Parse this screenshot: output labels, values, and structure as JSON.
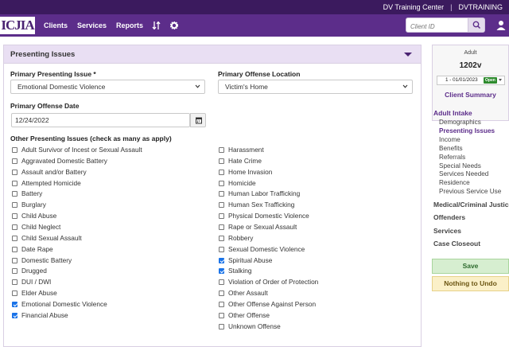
{
  "topbar": {
    "center": "DV Training Center",
    "separator": "|",
    "user": "DVTRAINING"
  },
  "navbar": {
    "logo": "ICJIA",
    "items": [
      "Clients",
      "Services",
      "Reports"
    ],
    "sort_icon": "sort-icon",
    "settings_icon": "gear-icon",
    "search": {
      "placeholder": "Client ID",
      "value": ""
    },
    "user_icon": "user-icon"
  },
  "panel": {
    "title": "Presenting Issues",
    "primary_issue_label": "Primary Presenting Issue *",
    "primary_issue_value": "Emotional Domestic Violence",
    "location_label": "Primary Offense Location",
    "location_value": "Victim's Home",
    "date_label": "Primary Offense Date",
    "date_value": "12/24/2022",
    "other_label": "Other Presenting Issues (check as many as apply)",
    "left_options": [
      {
        "label": "Adult Survivor of Incest or Sexual Assault",
        "checked": false
      },
      {
        "label": "Aggravated Domestic Battery",
        "checked": false
      },
      {
        "label": "Assault and/or Battery",
        "checked": false
      },
      {
        "label": "Attempted Homicide",
        "checked": false
      },
      {
        "label": "Battery",
        "checked": false
      },
      {
        "label": "Burglary",
        "checked": false
      },
      {
        "label": "Child Abuse",
        "checked": false
      },
      {
        "label": "Child Neglect",
        "checked": false
      },
      {
        "label": "Child Sexual Assault",
        "checked": false
      },
      {
        "label": "Date Rape",
        "checked": false
      },
      {
        "label": "Domestic Battery",
        "checked": false
      },
      {
        "label": "Drugged",
        "checked": false
      },
      {
        "label": "DUI / DWI",
        "checked": false
      },
      {
        "label": "Elder Abuse",
        "checked": false
      },
      {
        "label": "Emotional Domestic Violence",
        "checked": true
      },
      {
        "label": "Financial Abuse",
        "checked": true
      }
    ],
    "right_options": [
      {
        "label": "Harassment",
        "checked": false
      },
      {
        "label": "Hate Crime",
        "checked": false
      },
      {
        "label": "Home Invasion",
        "checked": false
      },
      {
        "label": "Homicide",
        "checked": false
      },
      {
        "label": "Human Labor Trafficking",
        "checked": false
      },
      {
        "label": "Human Sex Trafficking",
        "checked": false
      },
      {
        "label": "Physical Domestic Violence",
        "checked": false
      },
      {
        "label": "Rape or Sexual Assault",
        "checked": false
      },
      {
        "label": "Robbery",
        "checked": false
      },
      {
        "label": "Sexual Domestic Violence",
        "checked": false
      },
      {
        "label": "Spiritual Abuse",
        "checked": true
      },
      {
        "label": "Stalking",
        "checked": true
      },
      {
        "label": "Violation of Order of Protection",
        "checked": false
      },
      {
        "label": "Other Assault",
        "checked": false
      },
      {
        "label": "Other Offense Against Person",
        "checked": false
      },
      {
        "label": "Other Offense",
        "checked": false
      },
      {
        "label": "Unknown Offense",
        "checked": false
      }
    ]
  },
  "sidebar": {
    "client_type": "Adult",
    "client_id": "1202v",
    "case_select": "1 - 01/01/2023",
    "case_status": "Open",
    "summary_link": "Client Summary",
    "sections": [
      {
        "label": "Adult Intake",
        "active": true
      },
      {
        "label": "Medical/Criminal Justice",
        "active": false
      },
      {
        "label": "Offenders",
        "active": false
      },
      {
        "label": "Services",
        "active": false
      },
      {
        "label": "Case Closeout",
        "active": false
      }
    ],
    "intake_items": [
      {
        "label": "Demographics",
        "active": false
      },
      {
        "label": "Presenting Issues",
        "active": true
      },
      {
        "label": "Income",
        "active": false
      },
      {
        "label": "Benefits",
        "active": false
      },
      {
        "label": "Referrals",
        "active": false
      },
      {
        "label": "Special Needs",
        "active": false
      },
      {
        "label": "Services Needed",
        "active": false
      },
      {
        "label": "Residence",
        "active": false
      },
      {
        "label": "Previous Service Use",
        "active": false
      }
    ],
    "save_label": "Save",
    "undo_label": "Nothing to Undo"
  },
  "colors": {
    "header": "#3b1a5e",
    "nav": "#5c2d8a",
    "panel_head": "#e9dff3",
    "save": "#d6eed0",
    "undo": "#fbf0c8"
  }
}
